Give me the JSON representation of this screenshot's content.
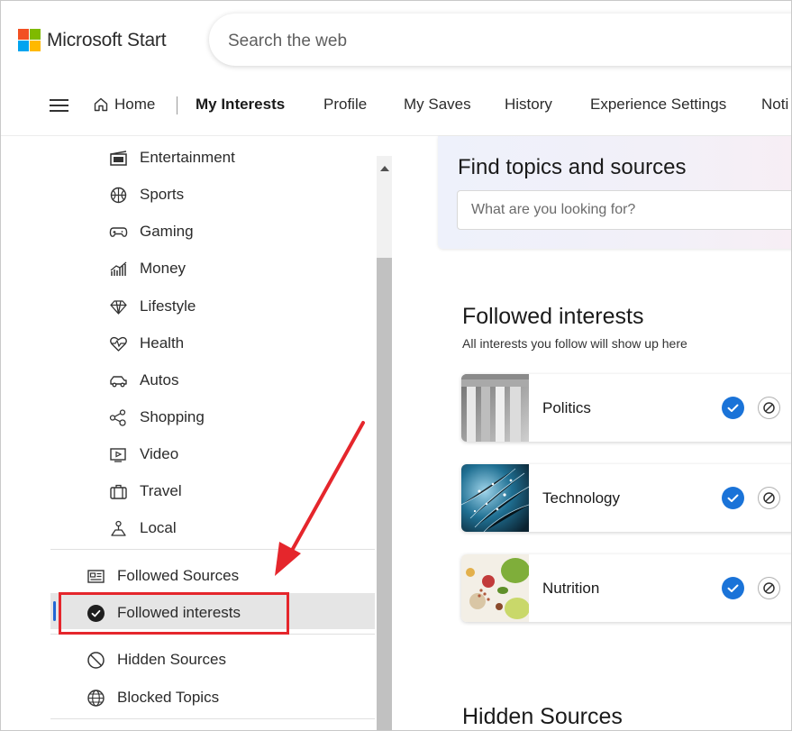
{
  "brand": {
    "name": "Microsoft Start",
    "logo_colors": [
      "#f25022",
      "#7fba00",
      "#00a4ef",
      "#ffb900"
    ]
  },
  "search": {
    "placeholder": "Search the web"
  },
  "nav": {
    "items": [
      "Home",
      "My Interests",
      "Profile",
      "My Saves",
      "History",
      "Experience Settings",
      "Noti"
    ],
    "active": "My Interests"
  },
  "sidebar": {
    "categories": [
      {
        "label": "Entertainment",
        "icon": "clapperboard-icon"
      },
      {
        "label": "Sports",
        "icon": "basketball-icon"
      },
      {
        "label": "Gaming",
        "icon": "gamepad-icon"
      },
      {
        "label": "Money",
        "icon": "chart-icon"
      },
      {
        "label": "Lifestyle",
        "icon": "diamond-icon"
      },
      {
        "label": "Health",
        "icon": "heartbeat-icon"
      },
      {
        "label": "Autos",
        "icon": "car-icon"
      },
      {
        "label": "Shopping",
        "icon": "shopping-nodes-icon"
      },
      {
        "label": "Video",
        "icon": "video-icon"
      },
      {
        "label": "Travel",
        "icon": "suitcase-icon"
      },
      {
        "label": "Local",
        "icon": "map-pin-icon"
      }
    ],
    "manage": [
      {
        "label": "Followed Sources",
        "icon": "newspaper-icon"
      },
      {
        "label": "Followed interests",
        "icon": "check-circle-icon",
        "active": true
      },
      {
        "label": "Hidden Sources",
        "icon": "block-icon"
      },
      {
        "label": "Blocked Topics",
        "icon": "globe-icon"
      }
    ]
  },
  "find": {
    "title": "Find topics and sources",
    "placeholder": "What are you looking for?"
  },
  "followed_interests": {
    "title": "Followed interests",
    "subtitle": "All interests you follow will show up here",
    "items": [
      {
        "name": "Politics"
      },
      {
        "name": "Technology"
      },
      {
        "name": "Nutrition"
      }
    ]
  },
  "hidden_sources": {
    "title": "Hidden Sources"
  },
  "colors": {
    "accent": "#1a73d8",
    "highlight": "#e5262c",
    "active_bar": "#2266d4"
  }
}
